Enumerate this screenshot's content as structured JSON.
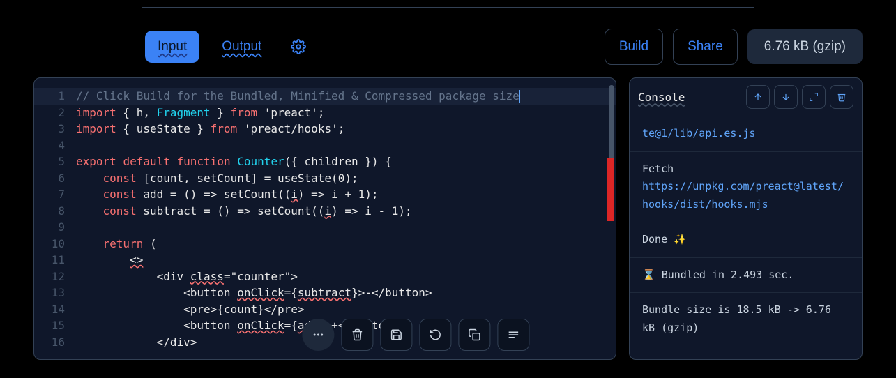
{
  "tabs": {
    "input": "Input",
    "output": "Output"
  },
  "actions": {
    "build": "Build",
    "share": "Share"
  },
  "bundle_badge": "6.76 kB (gzip)",
  "editor": {
    "line_numbers": [
      "1",
      "2",
      "3",
      "4",
      "5",
      "6",
      "7",
      "8",
      "9",
      "10",
      "11",
      "12",
      "13",
      "14",
      "15",
      "16"
    ],
    "lines": {
      "l1_comment": "// Click Build for the Bundled, Minified & Compressed package size",
      "l2_import": "import",
      "l2_h": "h",
      "l2_comma": ", ",
      "l2_fragment": "Fragment",
      "l2_from": "from",
      "l2_str": "'preact'",
      "l3_import": "import",
      "l3_usestate": "useState",
      "l3_from": "from",
      "l3_str": "'preact/hooks'",
      "l5_export": "export",
      "l5_default": "default",
      "l5_function": "function",
      "l5_counter": "Counter",
      "l5_args": "({ children }) {",
      "l6_const": "const",
      "l6_rest": " [count, setCount] = useState(0);",
      "l7_const": "const",
      "l7_add": " add = () => setCount((",
      "l7_i": "i",
      "l7_rest": ") => i + 1);",
      "l8_const": "const",
      "l8_sub": " subtract = () => setCount((",
      "l8_i": "i",
      "l8_rest": ") => i - 1);",
      "l10_return": "return",
      "l10_paren": " (",
      "l11_frag": "<>",
      "l12_div_open": "<div ",
      "l12_class": "class",
      "l12_div_rest": "=\"counter\">",
      "l13_btn_open": "<button ",
      "l13_onclick": "onClick",
      "l13_eq": "={",
      "l13_subtract": "subtract",
      "l13_close": "}>-</button>",
      "l14_pre": "<pre>{count}</pre>",
      "l15_btn_open": "<button ",
      "l15_onclick": "onClick",
      "l15_eq": "={",
      "l15_add": "add",
      "l15_close": "}>+</button>",
      "l16_divclose": "</div>"
    }
  },
  "console": {
    "title": "Console",
    "entries": {
      "e1_link": "te@1/lib/api.es.js",
      "e2_label": "Fetch",
      "e2_link": "https://unpkg.com/preact@latest/hooks/dist/hooks.mjs",
      "e3_done": "Done ✨",
      "e4_time": "⌛ Bundled in 2.493 sec.",
      "e5_size": "Bundle size is 18.5 kB -> 6.76 kB (gzip)"
    }
  }
}
